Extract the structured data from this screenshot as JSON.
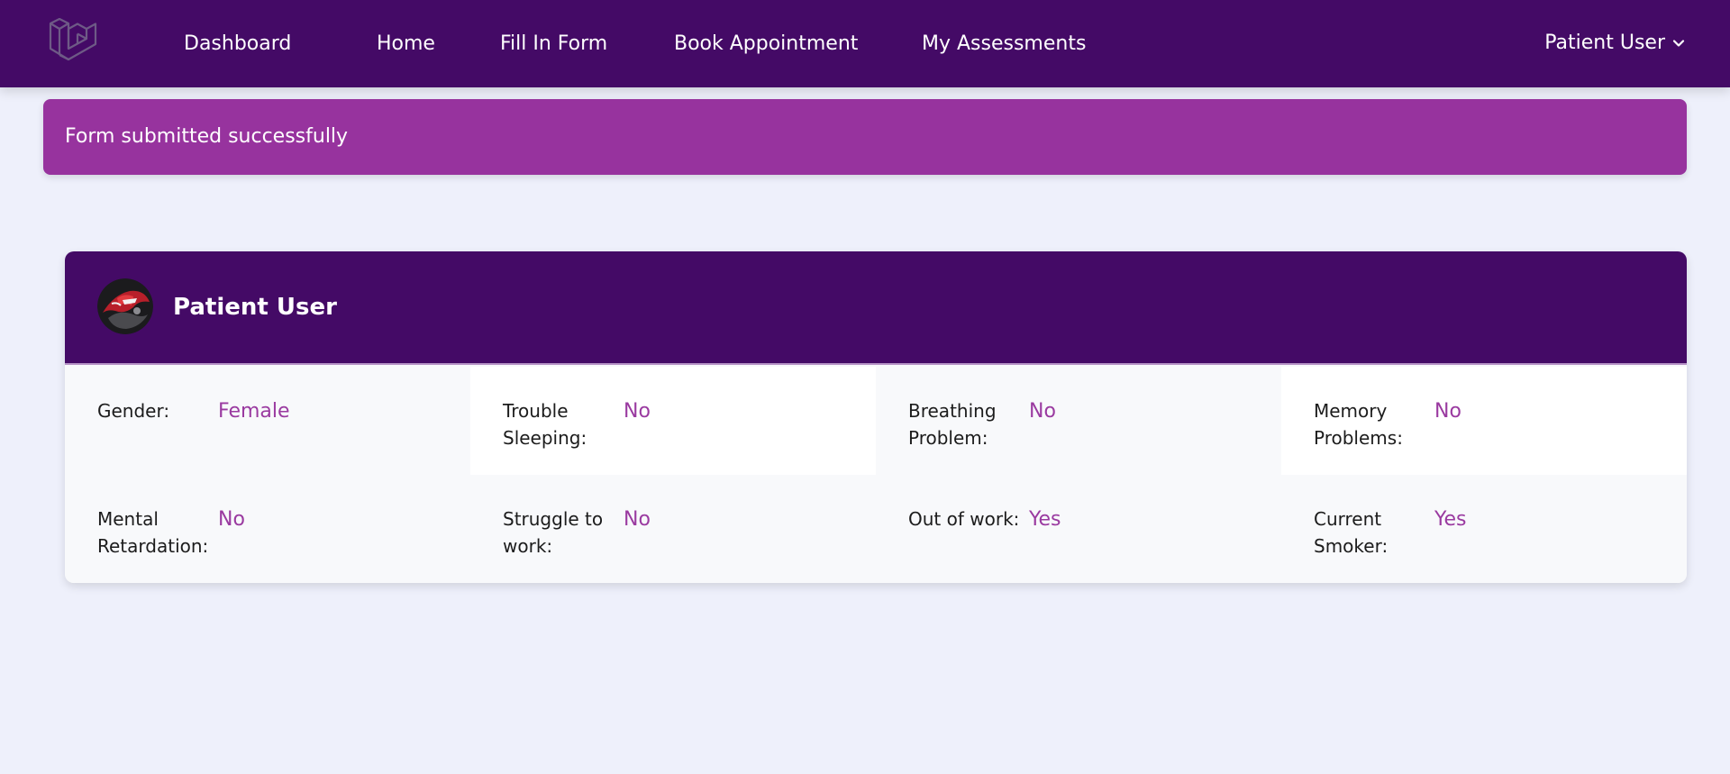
{
  "nav": {
    "logo_icon": "laravel-logo-icon",
    "links": [
      "Dashboard",
      "Home",
      "Fill In Form",
      "Book Appointment",
      "My Assessments"
    ],
    "user_label": "Patient User",
    "dropdown_icon": "chevron-down-icon"
  },
  "alert": {
    "message": "Form submitted successfully"
  },
  "card": {
    "user_name": "Patient User",
    "avatar_icon": "avatar-image",
    "fields": [
      {
        "label": "Gender:",
        "value": "Female"
      },
      {
        "label": "Trouble Sleeping:",
        "value": "No"
      },
      {
        "label": "Breathing Problem:",
        "value": "No"
      },
      {
        "label": "Memory Problems:",
        "value": "No"
      },
      {
        "label": "Mental Retardation:",
        "value": "No"
      },
      {
        "label": "Struggle to work:",
        "value": "No"
      },
      {
        "label": "Out of work:",
        "value": "Yes"
      },
      {
        "label": "Current Smoker:",
        "value": "Yes"
      }
    ]
  },
  "colors": {
    "navbar": "#440a66",
    "alert": "#97339e",
    "value_text": "#9a3aa0",
    "page_background": "#eef0fb"
  }
}
